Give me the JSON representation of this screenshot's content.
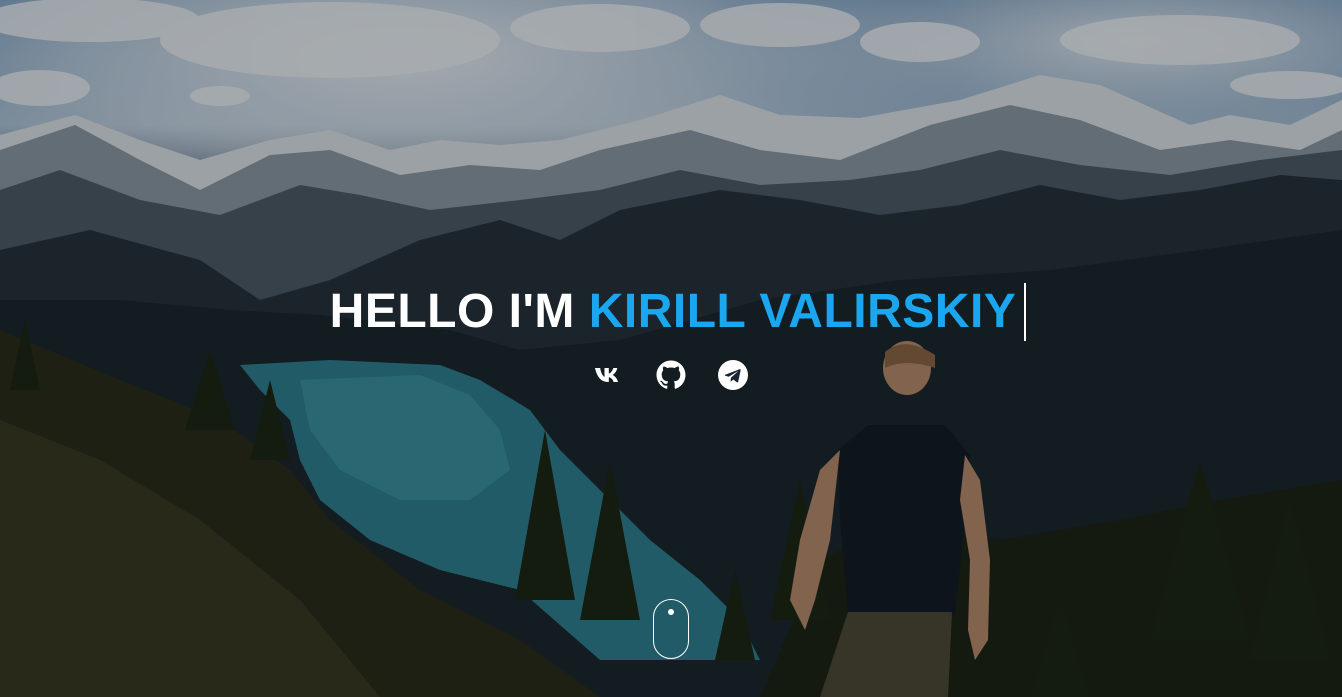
{
  "hero": {
    "greeting": "HELLO I'M ",
    "name": "KIRILL VALIRSKIY",
    "name_color": "#1aa7f0",
    "text_color": "#ffffff"
  },
  "socials": [
    {
      "icon": "vk-icon"
    },
    {
      "icon": "github-icon"
    },
    {
      "icon": "telegram-icon"
    }
  ],
  "scroll_indicator": {
    "icon": "scroll-mouse-icon"
  }
}
